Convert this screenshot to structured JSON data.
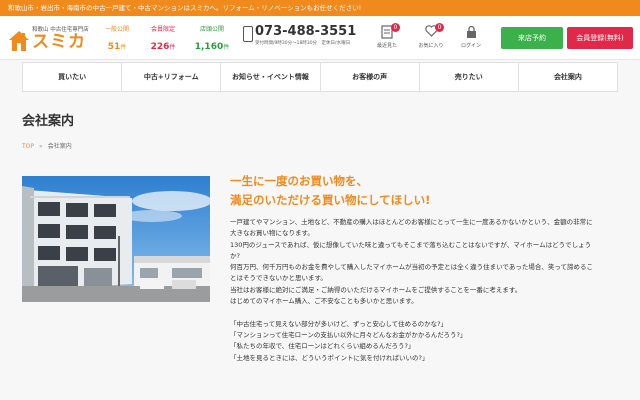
{
  "topbar": {
    "text": "和歌山市・岩出市・海南市の中古一戸建て・中古マンションはスミカへ。リフォーム・リノベーションもお任せください!"
  },
  "logo": {
    "small": "和歌山 中古住宅専門店",
    "main": "スミカ"
  },
  "stats": [
    {
      "label": "一般公開",
      "value": "51",
      "unit": "件"
    },
    {
      "label": "会員限定",
      "value": "226",
      "unit": "件"
    },
    {
      "label": "店頭公開",
      "value": "1,160",
      "unit": "件"
    }
  ],
  "phone": {
    "number": "073-488-3551",
    "hours": "受付時間/9時30分〜18時30分　定休日/水曜日"
  },
  "icons": [
    {
      "label": "最近見た",
      "badge": "0"
    },
    {
      "label": "お気に入り",
      "badge": "0"
    },
    {
      "label": "ログイン"
    }
  ],
  "buttons": {
    "visit": "来店予約",
    "register": "会員登録(無料)"
  },
  "nav": [
    "買いたい",
    "中古+リフォーム",
    "お知らせ・イベント情報",
    "お客様の声",
    "売りたい",
    "会社案内"
  ],
  "page": {
    "title": "会社案内"
  },
  "breadcrumb": {
    "top": "TOP",
    "separator": "»",
    "current": "会社案内"
  },
  "headline": {
    "line1": "一生に一度のお買い物を、",
    "line2": "満足のいただける買い物にしてほしい!"
  },
  "body": {
    "lines": [
      "一戸建てやマンション、土地など、不動産の購入はほとんどのお客様にとって一生に一度あるかないかという、金額の非常に",
      "大きなお買い物になります。",
      "130円のジュースであれば、仮に想像していた味と違ってもそこまで落ち込むことはないですが、マイホームはどうでしょう",
      "か?",
      "何百万円、何千万円ものお金を費やして購入したマイホームが当初の予定とは全く違う住まいであった場合、笑って諦めるこ",
      "とはそうできないかと思います。",
      "当社はお客様に絶対にご満足・ご納得のいただけるマイホームをご提供することを一番に考えます。",
      "はじめてのマイホーム購入、ご不安なことも多いかと思います。"
    ],
    "quotes": [
      "「中古住宅って見えない部分が多いけど、ずっと安心して住めるのかな?」",
      "「マンションって住宅ローンの支払い以外に月々どんなお金がかかるんだろう?」",
      "「私たちの年収で、住宅ローンはどれくらい組めるんだろう?」",
      "「土地を見るときには、どういうポイントに気を付ければいいの?」"
    ]
  },
  "colors": {
    "accent": "#f08a1c",
    "green": "#3cb04a",
    "red": "#e0294a"
  }
}
